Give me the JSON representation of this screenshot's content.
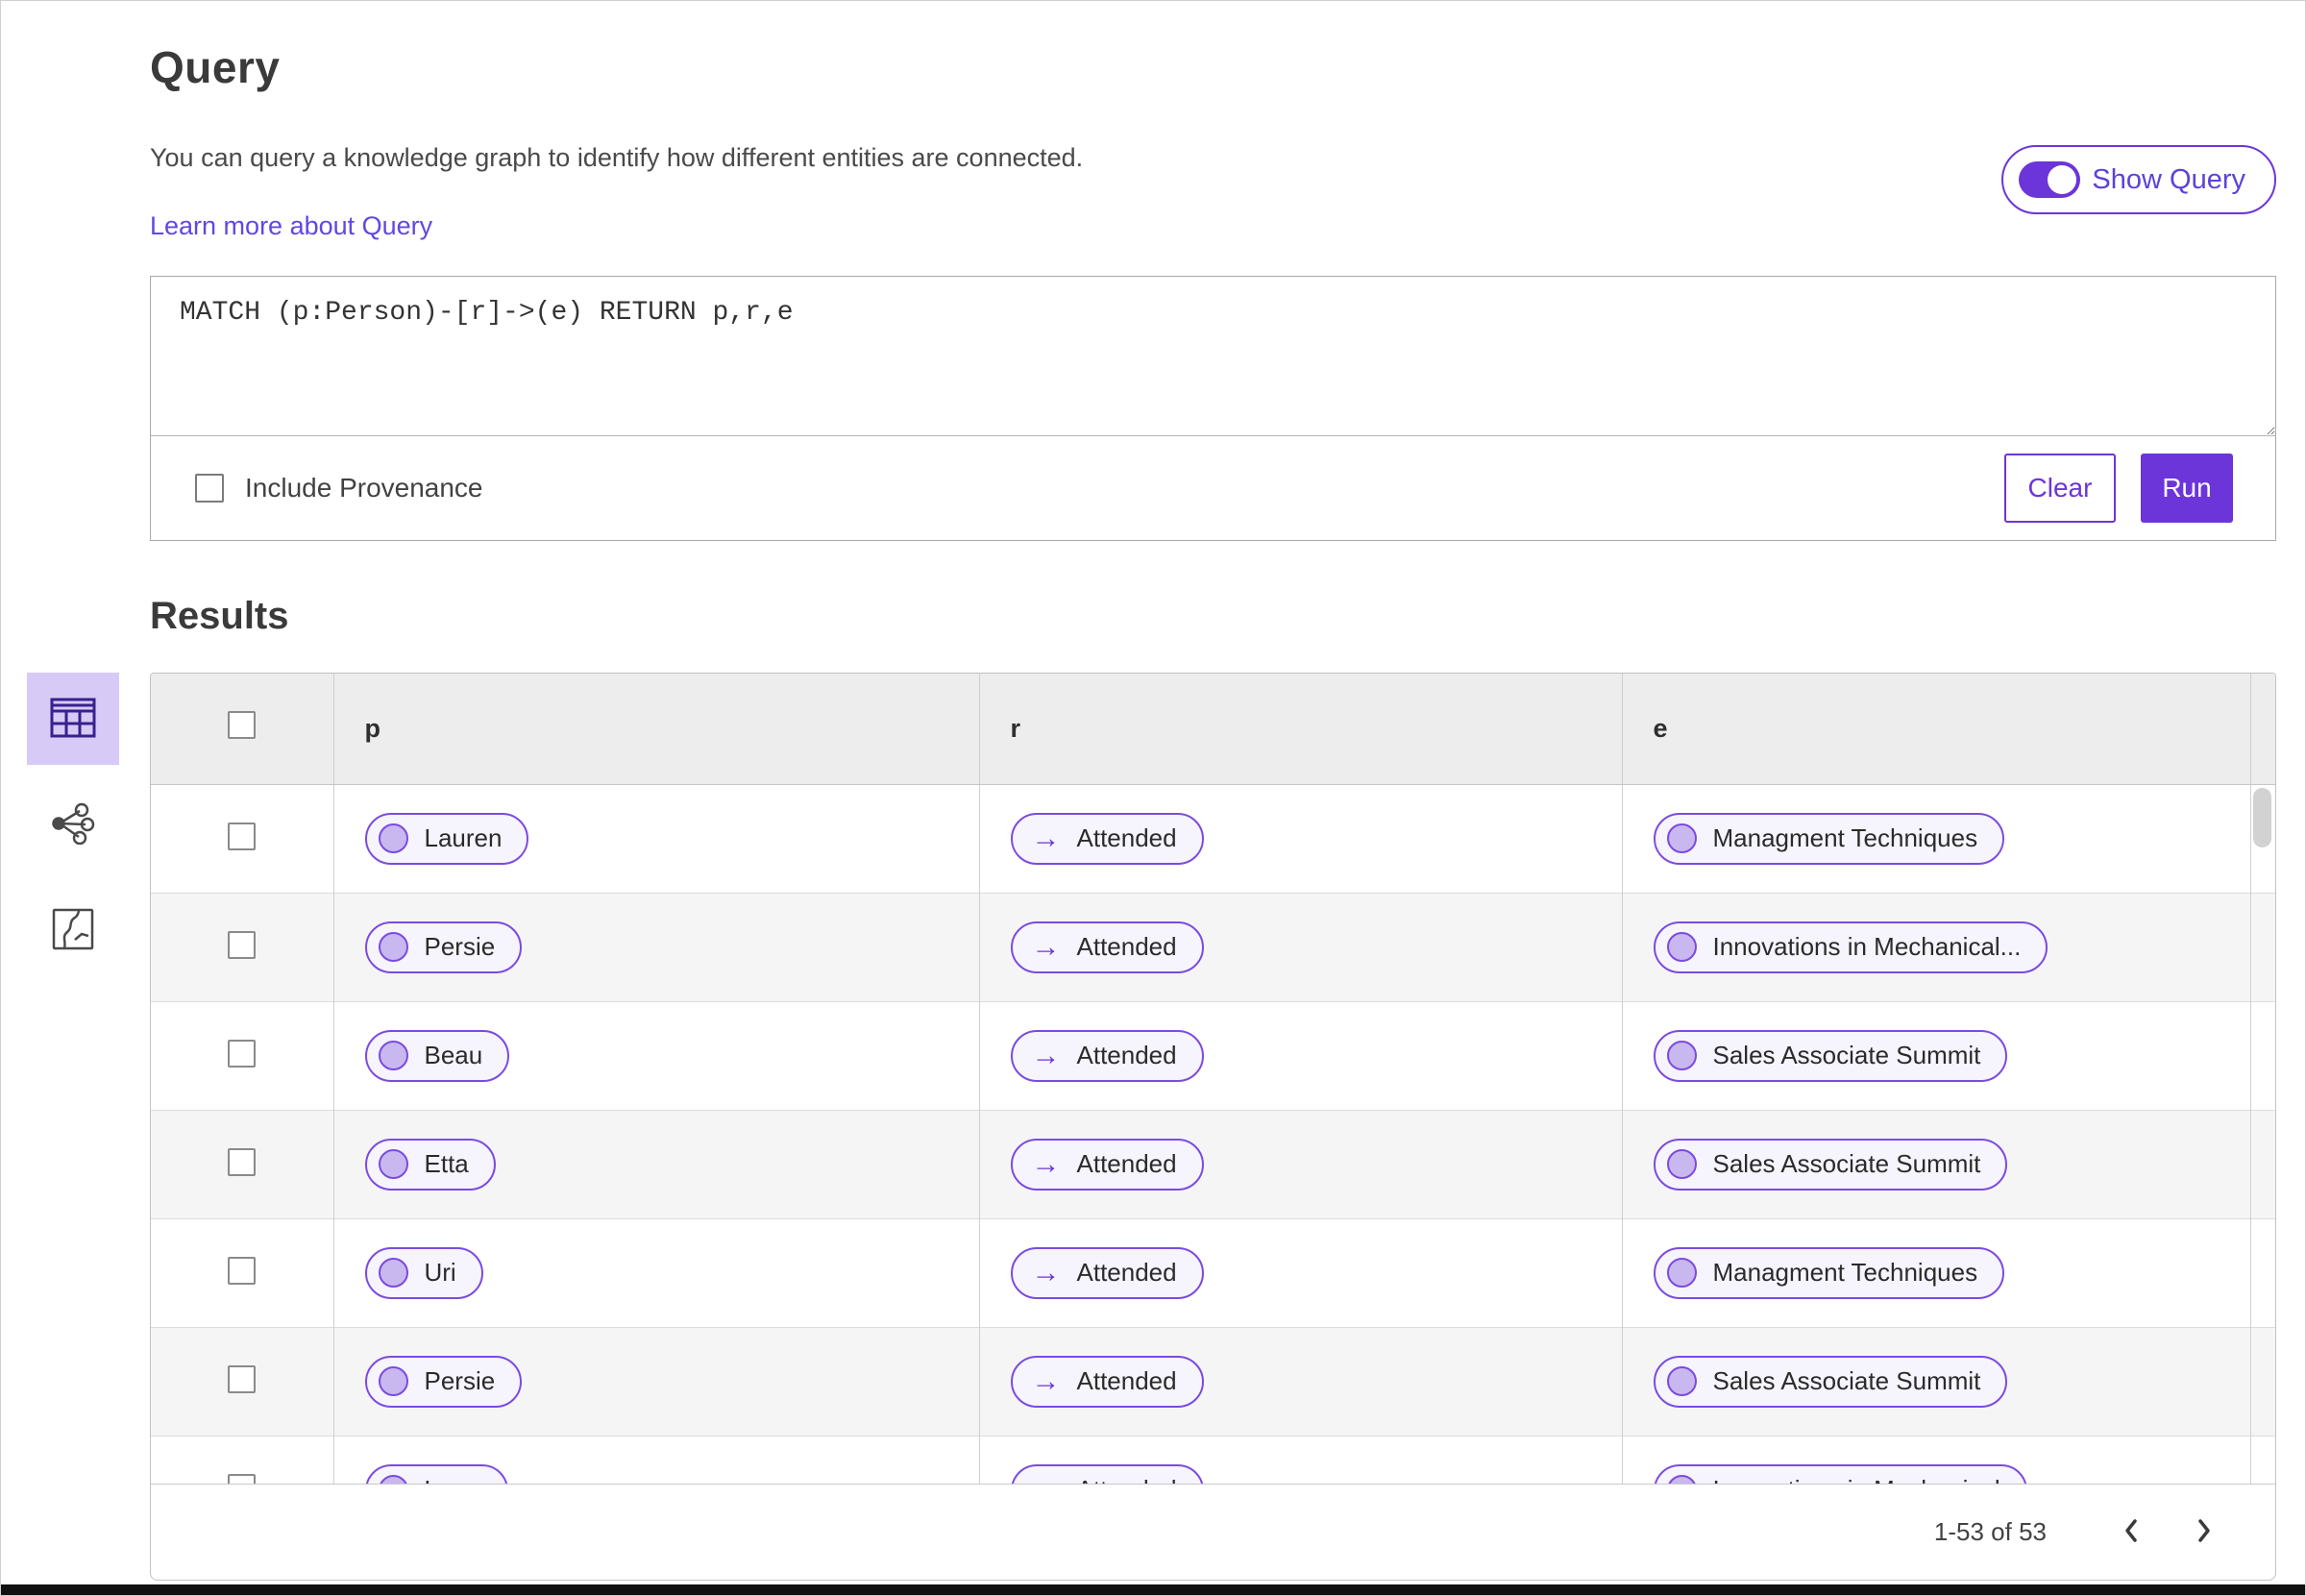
{
  "header": {
    "title": "Query",
    "description": "You can query a knowledge graph to identify how different entities are connected.",
    "learn_more_label": "Learn more about Query",
    "show_query_label": "Show Query",
    "show_query_on": true
  },
  "query": {
    "text": "MATCH (p:Person)-[r]->(e) RETURN p,r,e",
    "include_provenance_label": "Include Provenance",
    "include_provenance_checked": false,
    "clear_label": "Clear",
    "run_label": "Run"
  },
  "results": {
    "title": "Results",
    "view_switcher": [
      {
        "name": "table-view",
        "selected": true
      },
      {
        "name": "graph-view",
        "selected": false
      },
      {
        "name": "map-view",
        "selected": false
      }
    ],
    "table": {
      "columns": [
        "p",
        "r",
        "e"
      ],
      "relationship_arrow": "→",
      "rows": [
        {
          "p": "Lauren",
          "r": "Attended",
          "e": "Managment Techniques"
        },
        {
          "p": "Persie",
          "r": "Attended",
          "e": "Innovations in Mechanical..."
        },
        {
          "p": "Beau",
          "r": "Attended",
          "e": "Sales Associate Summit"
        },
        {
          "p": "Etta",
          "r": "Attended",
          "e": "Sales Associate Summit"
        },
        {
          "p": "Uri",
          "r": "Attended",
          "e": "Managment Techniques"
        },
        {
          "p": "Persie",
          "r": "Attended",
          "e": "Sales Associate Summit"
        },
        {
          "p": "Larry",
          "r": "Attended",
          "e": "Innovations in Mechanical"
        }
      ]
    },
    "pagination": {
      "range_label": "1-53 of 53"
    }
  },
  "colors": {
    "primary_purple": "#6c35d9",
    "pill_border": "#7b4be0",
    "pill_background": "#f6f4fd",
    "node_fill": "#c9b8ef",
    "link": "#6247e0",
    "selected_view_background": "#d8caf6",
    "header_row_background": "#ededee",
    "alt_row_background": "#f5f5f6"
  }
}
